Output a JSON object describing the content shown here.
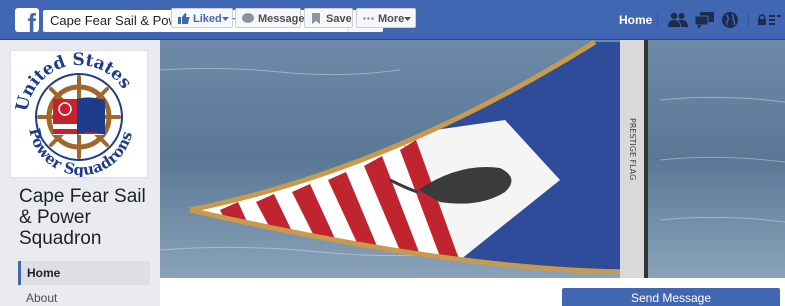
{
  "topbar": {
    "search_value": "Cape Fear Sail & Power Squadron",
    "nav_home": "Home",
    "brand_color": "#4267b2"
  },
  "profile": {
    "logo_text_top": "United States",
    "logo_text_bottom": "Power Squadrons",
    "page_name": "Cape Fear Sail & Power Squadron"
  },
  "cover": {
    "flag_text": "PRESTIGE FLAG"
  },
  "left_nav": {
    "home": "Home",
    "about": "About"
  },
  "actions": {
    "liked": "Liked",
    "message": "Message",
    "save": "Save",
    "more": "More",
    "send_message": "Send Message"
  }
}
